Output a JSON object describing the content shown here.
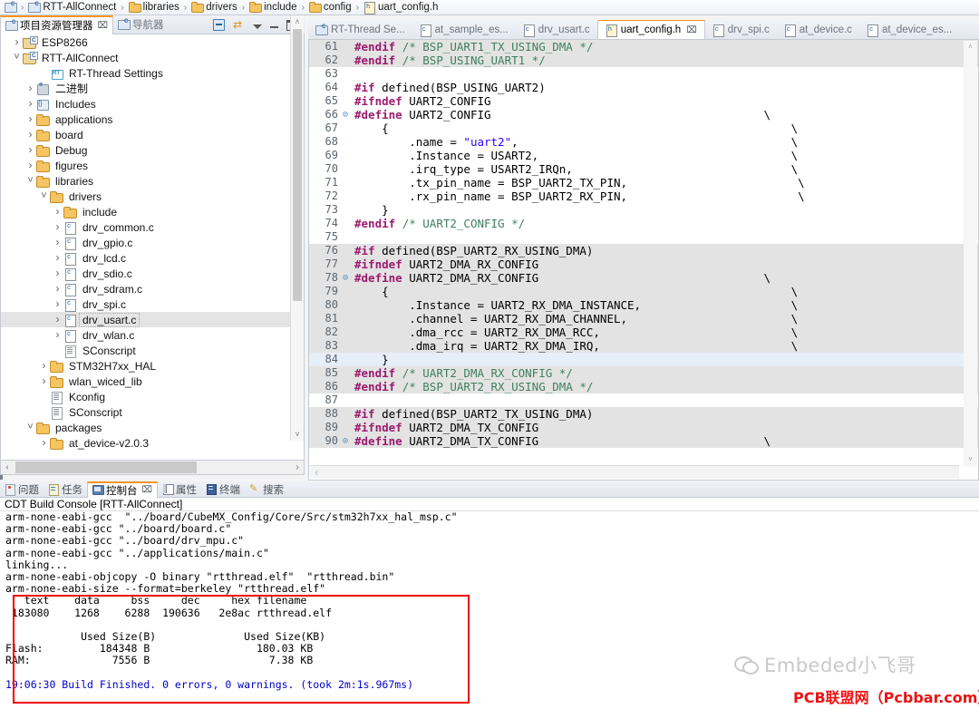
{
  "breadcrumb": {
    "name": "breadcrumb",
    "items": [
      {
        "icon": "project-icon",
        "label": ""
      },
      {
        "icon": "project-icon",
        "label": "RTT-AllConnect"
      },
      {
        "icon": "folder-icon",
        "label": "libraries"
      },
      {
        "icon": "folder-icon",
        "label": "drivers"
      },
      {
        "icon": "folder-icon",
        "label": "include"
      },
      {
        "icon": "folder-icon",
        "label": "config"
      },
      {
        "icon": "h-file-icon",
        "label": "uart_config.h"
      }
    ],
    "separator": "›"
  },
  "left_panel": {
    "tabs": [
      {
        "label": "项目资源管理器",
        "active": true,
        "close": "⌧"
      },
      {
        "label": "导航器",
        "active": false
      }
    ],
    "toolbar": [
      "collapse-all-icon",
      "link-with-editor-icon",
      "view-menu-icon",
      "minimize-icon",
      "maximize-icon"
    ],
    "tree": [
      {
        "indent": 0,
        "arrow": "closed",
        "icon": "project-icon",
        "label": "ESP8266",
        "selected": false
      },
      {
        "indent": 0,
        "arrow": "open",
        "icon": "project-icon",
        "label": "RTT-AllConnect",
        "selected": false
      },
      {
        "indent": 2,
        "arrow": "none",
        "icon": "rt-thread-icon",
        "label": "RT-Thread Settings",
        "selected": false
      },
      {
        "indent": 1,
        "arrow": "closed",
        "icon": "binary-icon",
        "label": "二进制",
        "selected": false
      },
      {
        "indent": 1,
        "arrow": "closed",
        "icon": "includes-icon",
        "label": "Includes",
        "selected": false
      },
      {
        "indent": 1,
        "arrow": "closed",
        "icon": "folder-icon",
        "label": "applications",
        "selected": false
      },
      {
        "indent": 1,
        "arrow": "closed",
        "icon": "folder-icon",
        "label": "board",
        "selected": false
      },
      {
        "indent": 1,
        "arrow": "closed",
        "icon": "folder-icon",
        "label": "Debug",
        "selected": false
      },
      {
        "indent": 1,
        "arrow": "closed",
        "icon": "folder-icon",
        "label": "figures",
        "selected": false
      },
      {
        "indent": 1,
        "arrow": "open",
        "icon": "folder-icon",
        "label": "libraries",
        "selected": false
      },
      {
        "indent": 2,
        "arrow": "open",
        "icon": "folder-icon",
        "label": "drivers",
        "selected": false
      },
      {
        "indent": 3,
        "arrow": "closed",
        "icon": "folder-icon",
        "label": "include",
        "selected": false
      },
      {
        "indent": 3,
        "arrow": "closed",
        "icon": "c-file-icon",
        "label": "drv_common.c",
        "selected": false
      },
      {
        "indent": 3,
        "arrow": "closed",
        "icon": "c-file-icon",
        "label": "drv_gpio.c",
        "selected": false
      },
      {
        "indent": 3,
        "arrow": "closed",
        "icon": "c-file-icon",
        "label": "drv_lcd.c",
        "selected": false
      },
      {
        "indent": 3,
        "arrow": "closed",
        "icon": "c-file-icon",
        "label": "drv_sdio.c",
        "selected": false
      },
      {
        "indent": 3,
        "arrow": "closed",
        "icon": "c-file-icon",
        "label": "drv_sdram.c",
        "selected": false
      },
      {
        "indent": 3,
        "arrow": "closed",
        "icon": "c-file-icon",
        "label": "drv_spi.c",
        "selected": false
      },
      {
        "indent": 3,
        "arrow": "closed",
        "icon": "c-file-icon",
        "label": "drv_usart.c",
        "selected": true
      },
      {
        "indent": 3,
        "arrow": "closed",
        "icon": "c-file-icon",
        "label": "drv_wlan.c",
        "selected": false
      },
      {
        "indent": 3,
        "arrow": "none",
        "icon": "script-file-icon",
        "label": "SConscript",
        "selected": false
      },
      {
        "indent": 2,
        "arrow": "closed",
        "icon": "folder-icon",
        "label": "STM32H7xx_HAL",
        "selected": false
      },
      {
        "indent": 2,
        "arrow": "closed",
        "icon": "folder-icon",
        "label": "wlan_wiced_lib",
        "selected": false
      },
      {
        "indent": 2,
        "arrow": "none",
        "icon": "script-file-icon",
        "label": "Kconfig",
        "selected": false
      },
      {
        "indent": 2,
        "arrow": "none",
        "icon": "script-file-icon",
        "label": "SConscript",
        "selected": false
      },
      {
        "indent": 1,
        "arrow": "open",
        "icon": "folder-icon",
        "label": "packages",
        "selected": false
      },
      {
        "indent": 2,
        "arrow": "closed",
        "icon": "folder-icon",
        "label": "at_device-v2.0.3",
        "selected": false
      }
    ],
    "hscroll_left": "‹",
    "hscroll_right": "›",
    "vscroll_up": "˄",
    "vscroll_down": "˅"
  },
  "editor": {
    "tabs": [
      {
        "label": "RT-Thread Se...",
        "icon": "rt-settings-icon",
        "active": false
      },
      {
        "label": "at_sample_es...",
        "icon": "c-file-icon",
        "active": false
      },
      {
        "label": "drv_usart.c",
        "icon": "c-file-icon",
        "active": false
      },
      {
        "label": "uart_config.h",
        "icon": "h-file-icon",
        "active": true,
        "close": "⌧"
      },
      {
        "label": "drv_spi.c",
        "icon": "c-file-icon",
        "active": false
      },
      {
        "label": "at_device.c",
        "icon": "c-file-icon",
        "active": false
      },
      {
        "label": "at_device_es...",
        "icon": "c-file-icon",
        "active": false
      }
    ],
    "lines": [
      {
        "n": "61",
        "fold": "",
        "hl": true,
        "cur": false,
        "parts": [
          {
            "t": "#endif",
            "c": "kw"
          },
          {
            "t": " ",
            "c": "bs"
          },
          {
            "t": "/* BSP_UART1_TX_USING_DMA */",
            "c": "cm"
          }
        ]
      },
      {
        "n": "62",
        "fold": "",
        "hl": true,
        "cur": false,
        "parts": [
          {
            "t": "#endif",
            "c": "kw"
          },
          {
            "t": " ",
            "c": "bs"
          },
          {
            "t": "/* BSP_USING_UART1 */",
            "c": "cm"
          }
        ]
      },
      {
        "n": "63",
        "fold": "",
        "hl": false,
        "cur": false,
        "parts": []
      },
      {
        "n": "64",
        "fold": "",
        "hl": false,
        "cur": false,
        "parts": [
          {
            "t": "#if",
            "c": "kw"
          },
          {
            "t": " defined(BSP_USING_UART2)",
            "c": "bs"
          }
        ]
      },
      {
        "n": "65",
        "fold": "",
        "hl": false,
        "cur": false,
        "parts": [
          {
            "t": "#ifndef",
            "c": "kw"
          },
          {
            "t": " UART2_CONFIG",
            "c": "bs"
          }
        ]
      },
      {
        "n": "66",
        "fold": "⊝",
        "hl": false,
        "cur": false,
        "parts": [
          {
            "t": "#define",
            "c": "kw"
          },
          {
            "t": " UART2_CONFIG                                        \\",
            "c": "bs"
          }
        ]
      },
      {
        "n": "67",
        "fold": "",
        "hl": false,
        "cur": false,
        "parts": [
          {
            "t": "    {                                                           \\",
            "c": "bs"
          }
        ]
      },
      {
        "n": "68",
        "fold": "",
        "hl": false,
        "cur": false,
        "parts": [
          {
            "t": "        .name = ",
            "c": "bs"
          },
          {
            "t": "\"uart2\"",
            "c": "st"
          },
          {
            "t": ",                                        \\",
            "c": "bs"
          }
        ]
      },
      {
        "n": "69",
        "fold": "",
        "hl": false,
        "cur": false,
        "parts": [
          {
            "t": "        .Instance = USART2,                                     \\",
            "c": "bs"
          }
        ]
      },
      {
        "n": "70",
        "fold": "",
        "hl": false,
        "cur": false,
        "parts": [
          {
            "t": "        .irq_type = USART2_IRQn,                                \\",
            "c": "bs"
          }
        ]
      },
      {
        "n": "71",
        "fold": "",
        "hl": false,
        "cur": false,
        "parts": [
          {
            "t": "        .tx_pin_name = BSP_UART2_TX_PIN,                         \\",
            "c": "bs"
          }
        ]
      },
      {
        "n": "72",
        "fold": "",
        "hl": false,
        "cur": false,
        "parts": [
          {
            "t": "        .rx_pin_name = BSP_UART2_RX_PIN,                         \\",
            "c": "bs"
          }
        ]
      },
      {
        "n": "73",
        "fold": "",
        "hl": false,
        "cur": false,
        "parts": [
          {
            "t": "    }",
            "c": "bs"
          }
        ]
      },
      {
        "n": "74",
        "fold": "",
        "hl": false,
        "cur": false,
        "parts": [
          {
            "t": "#endif",
            "c": "kw"
          },
          {
            "t": " ",
            "c": "bs"
          },
          {
            "t": "/* UART2_CONFIG */",
            "c": "cm"
          }
        ]
      },
      {
        "n": "75",
        "fold": "",
        "hl": false,
        "cur": false,
        "parts": []
      },
      {
        "n": "76",
        "fold": "",
        "hl": true,
        "cur": false,
        "parts": [
          {
            "t": "#if",
            "c": "kw"
          },
          {
            "t": " defined(BSP_UART2_RX_USING_DMA)",
            "c": "bs"
          }
        ]
      },
      {
        "n": "77",
        "fold": "",
        "hl": true,
        "cur": false,
        "parts": [
          {
            "t": "#ifndef",
            "c": "kw"
          },
          {
            "t": " UART2_DMA_RX_CONFIG",
            "c": "bs"
          }
        ]
      },
      {
        "n": "78",
        "fold": "⊝",
        "hl": true,
        "cur": false,
        "parts": [
          {
            "t": "#define",
            "c": "kw"
          },
          {
            "t": " UART2_DMA_RX_CONFIG                                 \\",
            "c": "bs"
          }
        ]
      },
      {
        "n": "79",
        "fold": "",
        "hl": true,
        "cur": false,
        "parts": [
          {
            "t": "    {                                                           \\",
            "c": "bs"
          }
        ]
      },
      {
        "n": "80",
        "fold": "",
        "hl": true,
        "cur": false,
        "parts": [
          {
            "t": "        .Instance = UART2_RX_DMA_INSTANCE,                      \\",
            "c": "bs"
          }
        ]
      },
      {
        "n": "81",
        "fold": "",
        "hl": true,
        "cur": false,
        "parts": [
          {
            "t": "        .channel = UART2_RX_DMA_CHANNEL,                        \\",
            "c": "bs"
          }
        ]
      },
      {
        "n": "82",
        "fold": "",
        "hl": true,
        "cur": false,
        "parts": [
          {
            "t": "        .dma_rcc = UART2_RX_DMA_RCC,                            \\",
            "c": "bs"
          }
        ]
      },
      {
        "n": "83",
        "fold": "",
        "hl": true,
        "cur": false,
        "parts": [
          {
            "t": "        .dma_irq = UART2_RX_DMA_IRQ,                            \\",
            "c": "bs"
          }
        ]
      },
      {
        "n": "84",
        "fold": "",
        "hl": false,
        "cur": true,
        "parts": [
          {
            "t": "    }",
            "c": "bs"
          }
        ]
      },
      {
        "n": "85",
        "fold": "",
        "hl": true,
        "cur": false,
        "parts": [
          {
            "t": "#endif",
            "c": "kw"
          },
          {
            "t": " ",
            "c": "bs"
          },
          {
            "t": "/* UART2_DMA_RX_CONFIG */",
            "c": "cm"
          }
        ]
      },
      {
        "n": "86",
        "fold": "",
        "hl": true,
        "cur": false,
        "parts": [
          {
            "t": "#endif",
            "c": "kw"
          },
          {
            "t": " ",
            "c": "bs"
          },
          {
            "t": "/* BSP_UART2_RX_USING_DMA */",
            "c": "cm"
          }
        ]
      },
      {
        "n": "87",
        "fold": "",
        "hl": false,
        "cur": false,
        "parts": []
      },
      {
        "n": "88",
        "fold": "",
        "hl": true,
        "cur": false,
        "parts": [
          {
            "t": "#if",
            "c": "kw"
          },
          {
            "t": " defined(BSP_UART2_TX_USING_DMA)",
            "c": "bs"
          }
        ]
      },
      {
        "n": "89",
        "fold": "",
        "hl": true,
        "cur": false,
        "parts": [
          {
            "t": "#ifndef",
            "c": "kw"
          },
          {
            "t": " UART2_DMA_TX_CONFIG",
            "c": "bs"
          }
        ]
      },
      {
        "n": "90",
        "fold": "⊝",
        "hl": true,
        "cur": false,
        "parts": [
          {
            "t": "#define",
            "c": "kw"
          },
          {
            "t": " UART2_DMA_TX_CONFIG                                 \\",
            "c": "bs"
          }
        ]
      }
    ]
  },
  "console": {
    "tabs": [
      {
        "label": "问题",
        "icon": "problems-icon",
        "active": false
      },
      {
        "label": "任务",
        "icon": "tasks-icon",
        "active": false
      },
      {
        "label": "控制台",
        "icon": "console-icon",
        "active": true,
        "close": "⌧"
      },
      {
        "label": "属性",
        "icon": "properties-icon",
        "active": false
      },
      {
        "label": "终端",
        "icon": "terminal-icon",
        "active": false
      },
      {
        "label": "搜索",
        "icon": "search-icon",
        "active": false
      }
    ],
    "title": "CDT Build Console [RTT-AllConnect]",
    "lines": [
      {
        "t": "arm-none-eabi-gcc  \"../board/CubeMX_Config/Core/Src/stm32h7xx_hal_msp.c\"",
        "blue": false
      },
      {
        "t": "arm-none-eabi-gcc \"../board/board.c\"",
        "blue": false
      },
      {
        "t": "arm-none-eabi-gcc \"../board/drv_mpu.c\"",
        "blue": false
      },
      {
        "t": "arm-none-eabi-gcc \"../applications/main.c\"",
        "blue": false
      },
      {
        "t": "linking...",
        "blue": false
      },
      {
        "t": "arm-none-eabi-objcopy -O binary \"rtthread.elf\"  \"rtthread.bin\"",
        "blue": false
      },
      {
        "t": "arm-none-eabi-size --format=berkeley \"rtthread.elf\"",
        "blue": false
      },
      {
        "t": "   text    data     bss     dec     hex filename",
        "blue": false
      },
      {
        "t": " 183080    1268    6288  190636   2e8ac rtthread.elf",
        "blue": false
      },
      {
        "t": "",
        "blue": false
      },
      {
        "t": "            Used Size(B)              Used Size(KB)",
        "blue": false
      },
      {
        "t": "Flash:         184348 B                 180.03 KB",
        "blue": false
      },
      {
        "t": "RAM:             7556 B                   7.38 KB",
        "blue": false
      },
      {
        "t": "",
        "blue": false
      },
      {
        "t": "19:06:30 Build Finished. 0 errors, 0 warnings. (took 2m:1s.967ms)",
        "blue": true
      }
    ],
    "highlight_box_color": "#ee0000"
  },
  "watermarks": {
    "wechat_text": "Embeded小飞哥",
    "pcb_text": "PCB联盟网（Pcbbar.com）",
    "pcb_color": "#ee1111"
  }
}
